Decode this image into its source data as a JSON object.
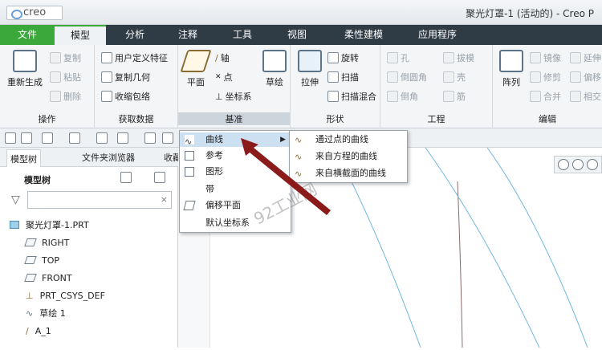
{
  "app": {
    "logo": "creo",
    "title": "聚光灯罩-1 (活动的) - Creo P"
  },
  "menu": [
    {
      "label": "文件"
    },
    {
      "label": "模型"
    },
    {
      "label": "分析"
    },
    {
      "label": "注释"
    },
    {
      "label": "工具"
    },
    {
      "label": "视图"
    },
    {
      "label": "柔性建模"
    },
    {
      "label": "应用程序"
    }
  ],
  "ribbon": {
    "operations": {
      "group": "操作",
      "regen": "重新生成",
      "copy": "复制",
      "paste": "粘贴",
      "delete": "删除"
    },
    "getdata": {
      "group": "获取数据",
      "udf": "用户定义特征",
      "copygeom": "复制几何",
      "shrinkwrap": "收缩包络"
    },
    "datum": {
      "group": "基准",
      "plane": "平面",
      "axis": "轴",
      "point": "点",
      "csys": "坐标系",
      "sketch": "草绘"
    },
    "shapes": {
      "group": "形状",
      "extrude": "拉伸",
      "revolve": "旋转",
      "sweep": "扫描",
      "sweptblend": "扫描混合"
    },
    "engineering": {
      "group": "工程",
      "hole": "孔",
      "round": "倒圆角",
      "chamfer": "倒角",
      "draft": "拔模",
      "shell": "壳",
      "rib": "筋"
    },
    "editing": {
      "group": "编辑",
      "pattern": "阵列",
      "mirror": "镜像",
      "trim": "修剪",
      "merge": "合并",
      "extend": "延伸",
      "offset": "偏移",
      "intersect": "相交"
    }
  },
  "panel": {
    "tabs": [
      "模型树",
      "文件夹浏览器",
      "收藏"
    ],
    "tree_label": "模型树"
  },
  "tree": {
    "items": [
      "聚光灯罩-1.PRT",
      "RIGHT",
      "TOP",
      "FRONT",
      "PRT_CSYS_DEF",
      "草绘 1",
      "A_1"
    ]
  },
  "dropdown": {
    "items": [
      "曲线",
      "参考",
      "图形",
      "带",
      "偏移平面",
      "默认坐标系"
    ]
  },
  "submenu": {
    "items": [
      "通过点的曲线",
      "来自方程的曲线",
      "来自横截面的曲线"
    ]
  },
  "watermark": "92工业网",
  "colors": {
    "file_tab": "#3aa83a",
    "menubar": "#2f3b45",
    "arrow": "#8b1a1a",
    "curve": "#6fb7e0"
  }
}
